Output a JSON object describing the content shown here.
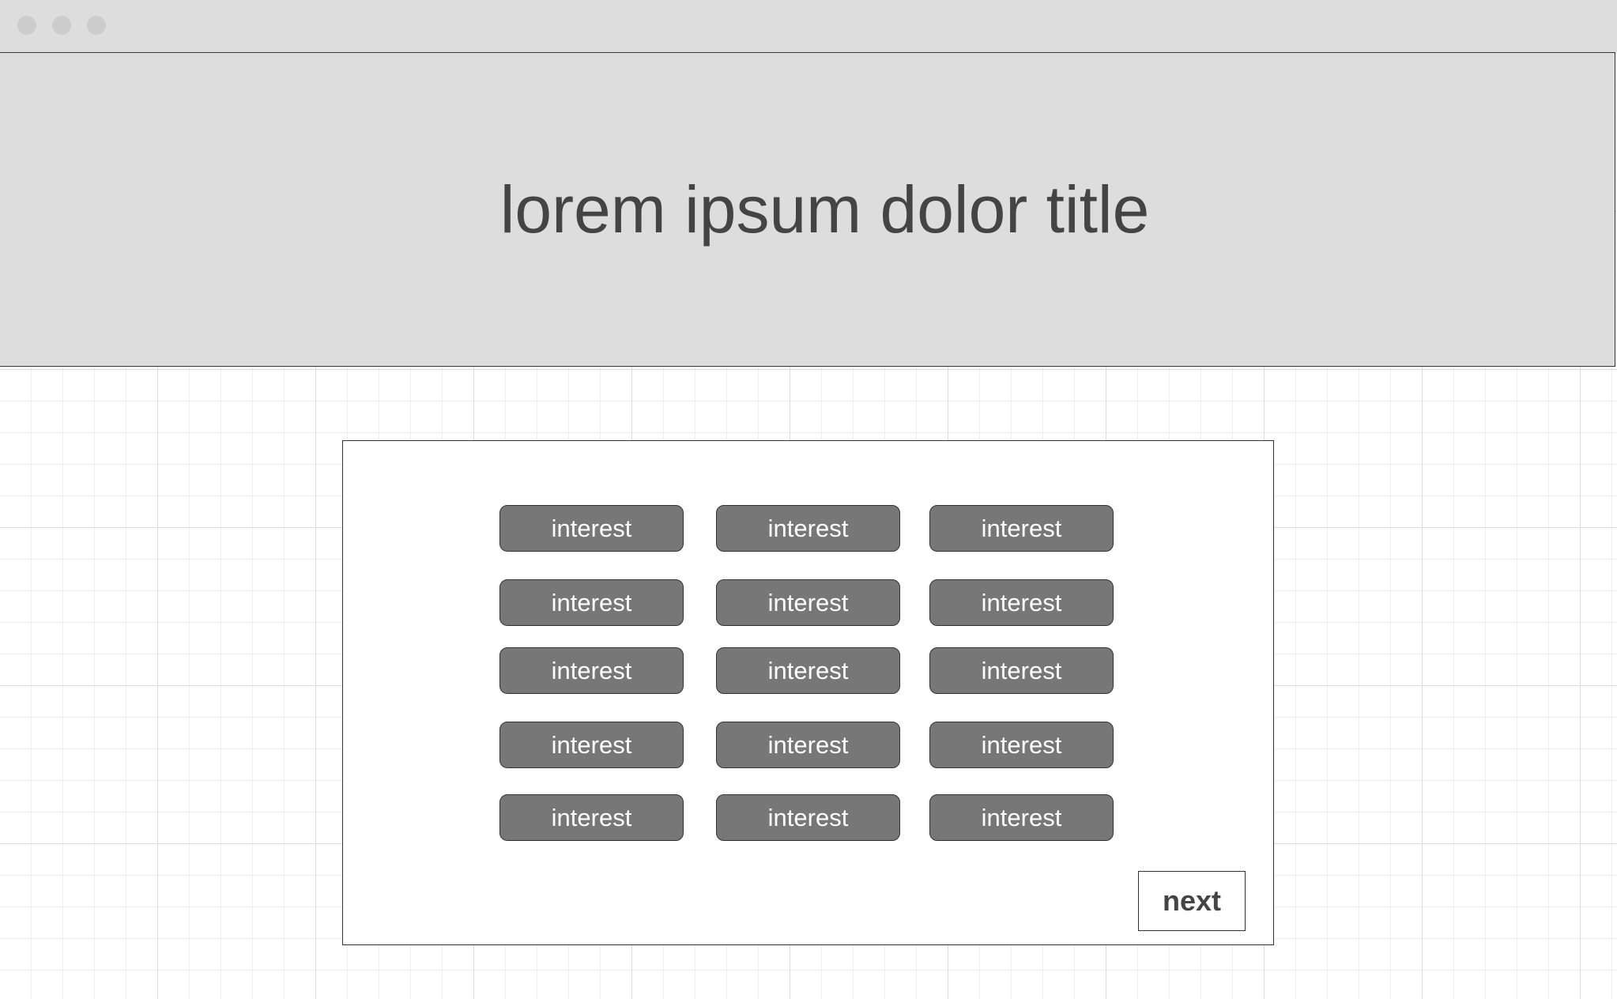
{
  "header": {
    "title": "lorem ipsum dolor title"
  },
  "interests": {
    "items": [
      "interest",
      "interest",
      "interest",
      "interest",
      "interest",
      "interest",
      "interest",
      "interest",
      "interest",
      "interest",
      "interest",
      "interest",
      "interest",
      "interest",
      "interest"
    ]
  },
  "actions": {
    "next_label": "next"
  },
  "colors": {
    "chrome_background": "#dddddd",
    "chip_fill": "#777777",
    "chip_text": "#ffffff",
    "border": "#333333",
    "title_text": "#444444"
  }
}
